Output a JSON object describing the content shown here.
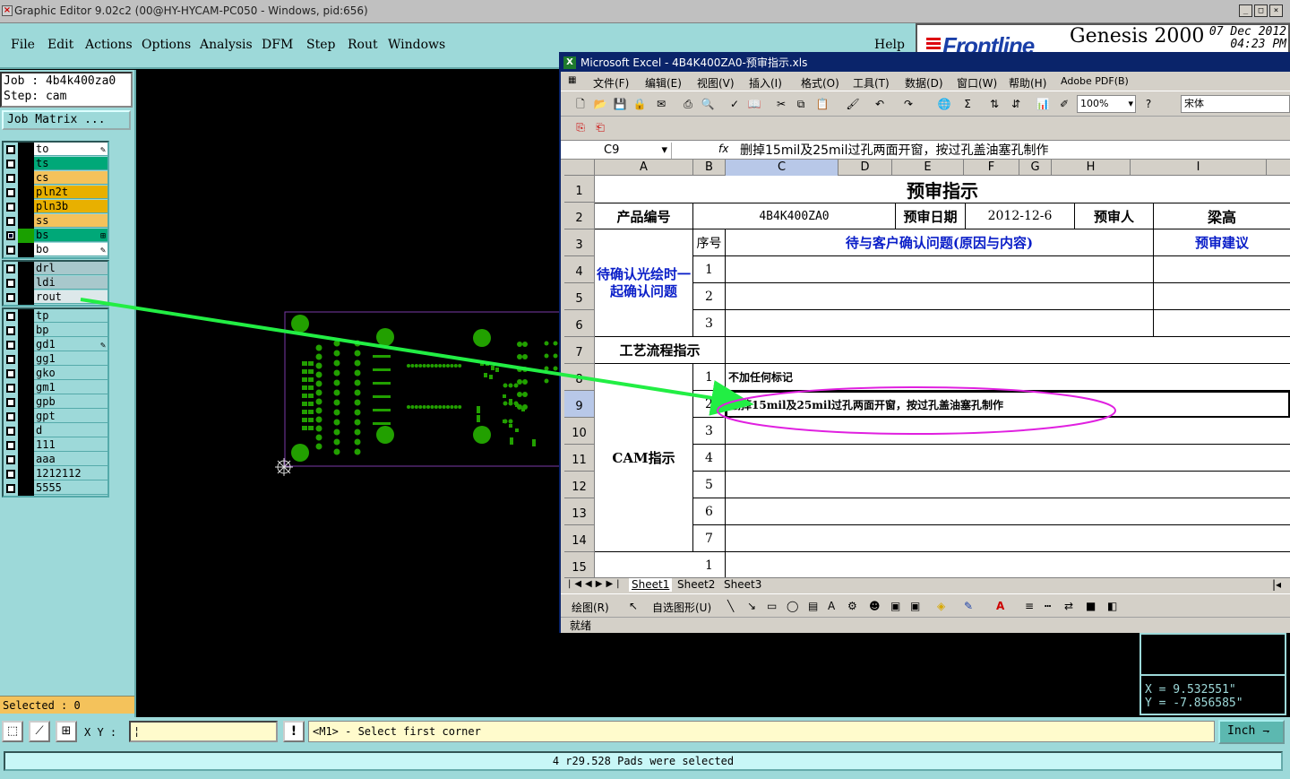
{
  "genesis": {
    "title": "Graphic Editor 9.02c2 (00@HY-HYCAM-PC050 - Windows, pid:656)",
    "menu": [
      "File",
      "Edit",
      "Actions",
      "Options",
      "Analysis",
      "DFM",
      "Step",
      "Rout",
      "Windows"
    ],
    "help": "Help",
    "logo_text": "Frontline",
    "product": "Genesis 2000",
    "date": "07 Dec 2012",
    "time": "04:23 PM",
    "job_label": "Job : 4b4k400za0",
    "step_label": "Step: cam",
    "job_matrix": "Job Matrix ...",
    "layers_group1": [
      {
        "name": "to",
        "color": "#ffffff",
        "mark": "✎"
      },
      {
        "name": "ts",
        "color": "#00a878",
        "mark": ""
      },
      {
        "name": "cs",
        "color": "#f4c25b",
        "mark": ""
      },
      {
        "name": "pln2t",
        "color": "#e8b000",
        "mark": ""
      },
      {
        "name": "pln3b",
        "color": "#e8b000",
        "mark": ""
      },
      {
        "name": "ss",
        "color": "#f4c25b",
        "mark": ""
      },
      {
        "name": "bs",
        "color": "#00a878",
        "mark": "⊞",
        "checked": true,
        "swatch": "#1aa000"
      },
      {
        "name": "bo",
        "color": "#ffffff",
        "mark": "✎"
      }
    ],
    "layers_group2": [
      {
        "name": "drl",
        "color": "#a8c8cc"
      },
      {
        "name": "ldi",
        "color": "#a8c8cc"
      },
      {
        "name": "rout",
        "color": "#dde8ea"
      }
    ],
    "layers_group3": [
      {
        "name": "tp",
        "color": "#9dd9d9",
        "mark": ""
      },
      {
        "name": "bp",
        "color": "#9dd9d9",
        "mark": ""
      },
      {
        "name": "gd1",
        "color": "#9dd9d9",
        "mark": "✎"
      },
      {
        "name": "gg1",
        "color": "#9dd9d9",
        "mark": ""
      },
      {
        "name": "gko",
        "color": "#9dd9d9",
        "mark": ""
      },
      {
        "name": "gm1",
        "color": "#9dd9d9",
        "mark": ""
      },
      {
        "name": "gpb",
        "color": "#9dd9d9",
        "mark": ""
      },
      {
        "name": "gpt",
        "color": "#9dd9d9",
        "mark": ""
      },
      {
        "name": "d",
        "color": "#9dd9d9",
        "mark": ""
      },
      {
        "name": "111",
        "color": "#9dd9d9",
        "mark": ""
      },
      {
        "name": "aaa",
        "color": "#9dd9d9",
        "mark": ""
      },
      {
        "name": "1212112",
        "color": "#9dd9d9",
        "mark": ""
      },
      {
        "name": "5555",
        "color": "#9dd9d9",
        "mark": ""
      }
    ],
    "selected": "Selected : 0",
    "coord_x": "X =  9.532551\"",
    "coord_y": "Y = -7.856585\"",
    "xy_label": "X Y :",
    "prompt": "<M1> - Select first corner",
    "units": "Inch",
    "status": "4 r29.528 Pads were selected"
  },
  "excel": {
    "title": "Microsoft Excel - 4B4K400ZA0-预审指示.xls",
    "menu": [
      "文件(F)",
      "编辑(E)",
      "视图(V)",
      "插入(I)",
      "格式(O)",
      "工具(T)",
      "数据(D)",
      "窗口(W)",
      "帮助(H)",
      "Adobe PDF(B)"
    ],
    "zoom": "100%",
    "font": "宋体",
    "name_box": "C9",
    "fx": "fx",
    "formula": "删掉15mil及25mil过孔两面开窗，按过孔盖油塞孔制作",
    "columns": [
      "A",
      "B",
      "C",
      "D",
      "E",
      "F",
      "G",
      "H",
      "I"
    ],
    "rows": [
      "1",
      "2",
      "3",
      "4",
      "5",
      "6",
      "7",
      "8",
      "9",
      "10",
      "11",
      "12",
      "13",
      "14",
      "15"
    ],
    "cells": {
      "title": "预审指示",
      "product_no_label": "产品编号",
      "product_no": "4B4K400ZA0",
      "review_date_label": "预审日期",
      "review_date": "2012-12-6",
      "reviewer_label": "预审人",
      "reviewer": "梁高",
      "seq_label": "序号",
      "issues_header": "待与客户确认问题(原因与内容)",
      "suggestion_header": "预审建议",
      "pending_label": "待确认光绘时一起确认问题",
      "seq_a": [
        "1",
        "2",
        "3"
      ],
      "process_label": "工艺流程指示",
      "cam_label": "CAM指示",
      "seq_b": [
        "1",
        "2",
        "3",
        "4",
        "5",
        "6",
        "7"
      ],
      "cam_1": "不加任何标记",
      "cam_2": "删掉15mil及25mil过孔两面开窗，按过孔盖油塞孔制作",
      "row15_seq": "1"
    },
    "sheets": [
      "Sheet1",
      "Sheet2",
      "Sheet3"
    ],
    "draw_label": "绘图(R)",
    "autoshape_label": "自选图形(U)",
    "status": "就绪"
  },
  "colors": {
    "pad_green": "#22a000",
    "arrow_green": "#22ee44",
    "ellipse_magenta": "#e020e0",
    "panel_cyan": "#9dd9d9"
  }
}
